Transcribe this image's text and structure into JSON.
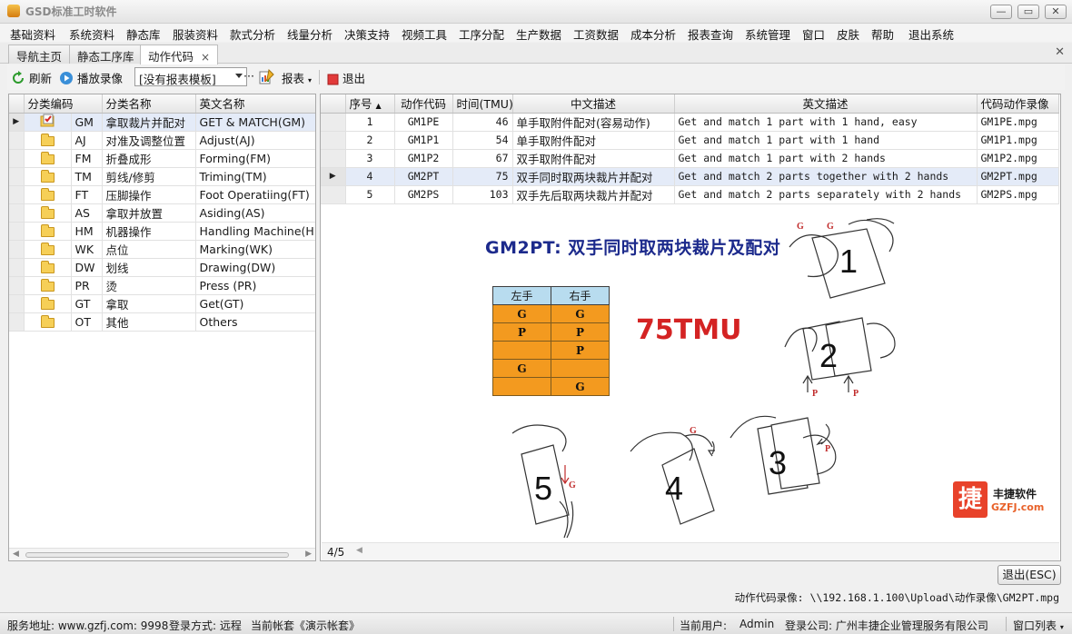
{
  "window": {
    "title": "GSD标准工时软件"
  },
  "menu": [
    "基础资料",
    "系统资料",
    "静态库",
    "服装资料",
    "款式分析",
    "线量分析",
    "决策支持",
    "视频工具",
    "工序分配",
    "生产数据",
    "工资数据",
    "成本分析",
    "报表查询",
    "系统管理",
    "窗口",
    "皮肤",
    "帮助",
    "退出系统"
  ],
  "tabs": [
    {
      "label": "导航主页"
    },
    {
      "label": "静态工序库"
    },
    {
      "label": "动作代码",
      "closable": "×"
    }
  ],
  "toolbar": {
    "refresh": "刷新",
    "play": "播放录像",
    "template": "[没有报表模板]",
    "more": "···",
    "report": "报表",
    "exit": "退出"
  },
  "left_table": {
    "headers": [
      "分类编码",
      "分类名称",
      "英文名称"
    ],
    "rows": [
      {
        "code": "GM",
        "name": "拿取裁片并配对",
        "en": "GET & MATCH(GM)"
      },
      {
        "code": "AJ",
        "name": "对准及调整位置",
        "en": "Adjust(AJ)"
      },
      {
        "code": "FM",
        "name": "折叠成形",
        "en": "Forming(FM)"
      },
      {
        "code": "TM",
        "name": "剪线/修剪",
        "en": "Triming(TM)"
      },
      {
        "code": "FT",
        "name": "压脚操作",
        "en": "Foot Operatiing(FT)"
      },
      {
        "code": "AS",
        "name": "拿取并放置",
        "en": "Asiding(AS)"
      },
      {
        "code": "HM",
        "name": "机器操作",
        "en": "Handling Machine(HM)"
      },
      {
        "code": "WK",
        "name": "点位",
        "en": "Marking(WK)"
      },
      {
        "code": "DW",
        "name": "划线",
        "en": "Drawing(DW)"
      },
      {
        "code": "PR",
        "name": "烫",
        "en": "Press (PR)"
      },
      {
        "code": "GT",
        "name": "拿取",
        "en": "Get(GT)"
      },
      {
        "code": "OT",
        "name": "其他",
        "en": "Others"
      }
    ]
  },
  "right_table": {
    "headers": [
      "序号",
      "动作代码",
      "时间(TMU)",
      "中文描述",
      "英文描述",
      "代码动作录像"
    ],
    "rows": [
      {
        "no": "1",
        "code": "GM1PE",
        "tmu": "46",
        "cn": "单手取附件配对(容易动作)",
        "en": "Get and match 1 part with 1 hand, easy",
        "video": "GM1PE.mpg"
      },
      {
        "no": "2",
        "code": "GM1P1",
        "tmu": "54",
        "cn": "单手取附件配对",
        "en": "Get and match 1 part with 1 hand",
        "video": "GM1P1.mpg"
      },
      {
        "no": "3",
        "code": "GM1P2",
        "tmu": "67",
        "cn": "双手取附件配对",
        "en": "Get and match 1 part with 2 hands",
        "video": "GM1P2.mpg"
      },
      {
        "no": "4",
        "code": "GM2PT",
        "tmu": "75",
        "cn": "双手同时取两块裁片并配对",
        "en": "Get and match 2 parts together with 2 hands",
        "video": "GM2PT.mpg"
      },
      {
        "no": "5",
        "code": "GM2PS",
        "tmu": "103",
        "cn": "双手先后取两块裁片并配对",
        "en": "Get and match 2 parts separately with 2 hands",
        "video": "GM2PS.mpg"
      }
    ]
  },
  "illustration": {
    "title": "GM2PT: 双手同时取两块裁片及配对",
    "tmu_label": "75TMU",
    "hand_table": {
      "headers": [
        "左手",
        "右手"
      ],
      "rows": [
        [
          "G",
          "G"
        ],
        [
          "P",
          "P"
        ],
        [
          "",
          "P"
        ],
        [
          "G",
          ""
        ],
        [
          "",
          "G"
        ]
      ]
    },
    "step_numbers": [
      "1",
      "2",
      "3",
      "4",
      "5"
    ],
    "marks": [
      "G",
      "G",
      "P",
      "P",
      "G",
      "P",
      "G"
    ],
    "logo": {
      "char": "捷",
      "name": "丰捷软件",
      "site": "GZFJ.com"
    }
  },
  "pager": "4/5",
  "exit_button": "退出(ESC)",
  "video_path": "动作代码录像: \\\\192.168.1.100\\Upload\\动作录像\\GM2PT.mpg",
  "status": {
    "server": "服务地址: www.gzfj.com: 9998",
    "login_mode": "登录方式: 远程",
    "account": "当前帐套《演示帐套》",
    "user_label": "当前用户:",
    "user": "Admin",
    "company": "登录公司: 广州丰捷企业管理服务有限公司",
    "window_list": "窗口列表"
  },
  "colors": {
    "accent_blue": "#1c2a8c",
    "tmu_red": "#d42323",
    "orange": "#f39a1f"
  }
}
